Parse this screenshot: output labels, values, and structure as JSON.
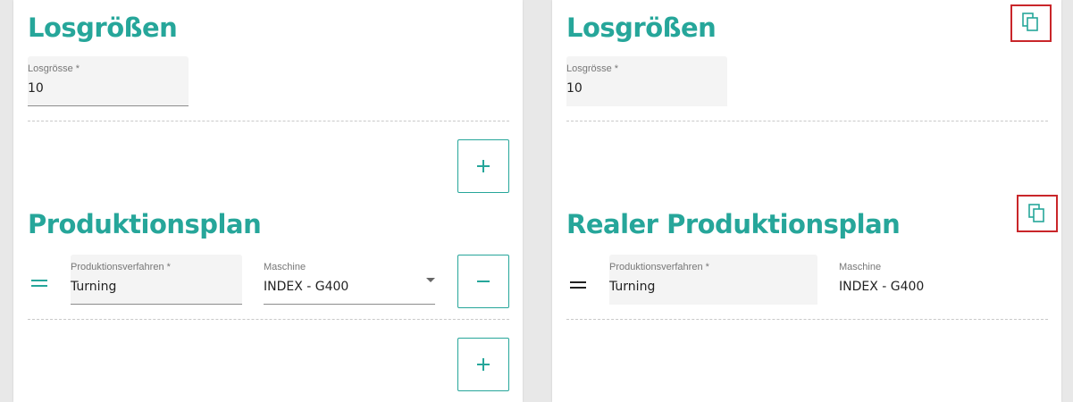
{
  "colors": {
    "accent": "#26a69a",
    "highlight_box": "#c9262a"
  },
  "left_panel": {
    "lot_title": "Losgrößen",
    "lot_field": {
      "label": "Losgrösse *",
      "value": "10"
    },
    "add_lot_icon": "plus-icon",
    "plan_title": "Produktionsplan",
    "plan_row": {
      "drag_icon": "drag-handle-icon",
      "process": {
        "label": "Produktionsverfahren *",
        "value": "Turning"
      },
      "machine": {
        "label": "Maschine",
        "value": "INDEX - G400"
      },
      "remove_icon": "minus-icon"
    },
    "add_plan_icon": "plus-icon"
  },
  "right_panel": {
    "lot_title": "Losgrößen",
    "copy_icon": "copy-icon",
    "lot_field": {
      "label": "Losgrösse *",
      "value": "10"
    },
    "plan_title": "Realer Produktionsplan",
    "plan_copy_icon": "copy-icon",
    "plan_row": {
      "drag_icon": "drag-handle-icon",
      "process": {
        "label": "Produktionsverfahren *",
        "value": "Turning"
      },
      "machine": {
        "label": "Maschine",
        "value": "INDEX - G400"
      }
    }
  }
}
